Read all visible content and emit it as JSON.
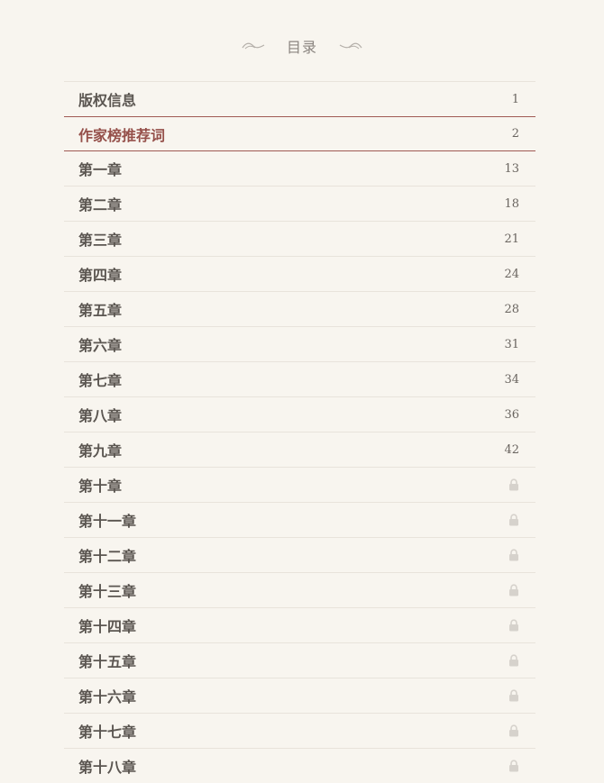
{
  "header": {
    "title": "目录"
  },
  "colors": {
    "background": "#f8f5ef",
    "active_accent": "#95504a",
    "active_border": "#a05a54",
    "divider": "#e8e3db",
    "lock": "#d6d2cc"
  },
  "toc": {
    "active_index": 1,
    "items": [
      {
        "label": "版权信息",
        "page": "1",
        "locked": false
      },
      {
        "label": "作家榜推荐词",
        "page": "2",
        "locked": false
      },
      {
        "label": "第一章",
        "page": "13",
        "locked": false
      },
      {
        "label": "第二章",
        "page": "18",
        "locked": false
      },
      {
        "label": "第三章",
        "page": "21",
        "locked": false
      },
      {
        "label": "第四章",
        "page": "24",
        "locked": false
      },
      {
        "label": "第五章",
        "page": "28",
        "locked": false
      },
      {
        "label": "第六章",
        "page": "31",
        "locked": false
      },
      {
        "label": "第七章",
        "page": "34",
        "locked": false
      },
      {
        "label": "第八章",
        "page": "36",
        "locked": false
      },
      {
        "label": "第九章",
        "page": "42",
        "locked": false
      },
      {
        "label": "第十章",
        "page": "",
        "locked": true,
        "icon": "lock-icon"
      },
      {
        "label": "第十一章",
        "page": "",
        "locked": true,
        "icon": "lock-icon"
      },
      {
        "label": "第十二章",
        "page": "",
        "locked": true,
        "icon": "lock-icon"
      },
      {
        "label": "第十三章",
        "page": "",
        "locked": true,
        "icon": "lock-icon"
      },
      {
        "label": "第十四章",
        "page": "",
        "locked": true,
        "icon": "lock-icon"
      },
      {
        "label": "第十五章",
        "page": "",
        "locked": true,
        "icon": "lock-icon"
      },
      {
        "label": "第十六章",
        "page": "",
        "locked": true,
        "icon": "lock-icon"
      },
      {
        "label": "第十七章",
        "page": "",
        "locked": true,
        "icon": "lock-icon"
      },
      {
        "label": "第十八章",
        "page": "",
        "locked": true,
        "icon": "lock-icon"
      }
    ]
  }
}
